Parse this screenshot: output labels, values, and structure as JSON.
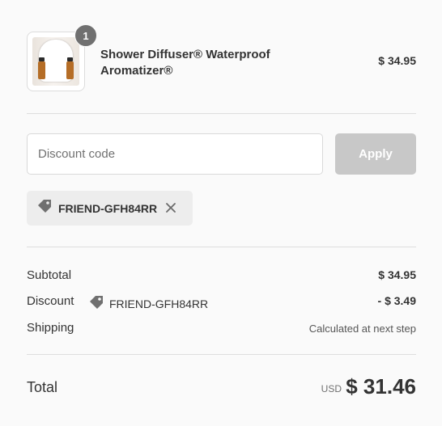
{
  "cart": {
    "item": {
      "quantity": "1",
      "title": "Shower Diffuser® Waterproof Aromatizer®",
      "price": "$ 34.95",
      "image_icon": "shower-diffuser-product-image"
    }
  },
  "discount": {
    "placeholder": "Discount code",
    "apply_label": "Apply",
    "applied_code": "FRIEND-GFH84RR"
  },
  "summary": {
    "subtotal_label": "Subtotal",
    "subtotal_value": "$ 34.95",
    "discount_label": "Discount",
    "discount_code": "FRIEND-GFH84RR",
    "discount_value": "- $ 3.49",
    "shipping_label": "Shipping",
    "shipping_value": "Calculated at next step",
    "total_label": "Total",
    "currency": "USD",
    "total_value": "$ 31.46"
  },
  "colors": {
    "background": "#fafafa",
    "apply_button_disabled": "#c8c8c8",
    "chip_background": "#ededed",
    "badge": "#707070",
    "text": "#333333"
  },
  "icons": [
    "tag-icon",
    "close-icon"
  ]
}
